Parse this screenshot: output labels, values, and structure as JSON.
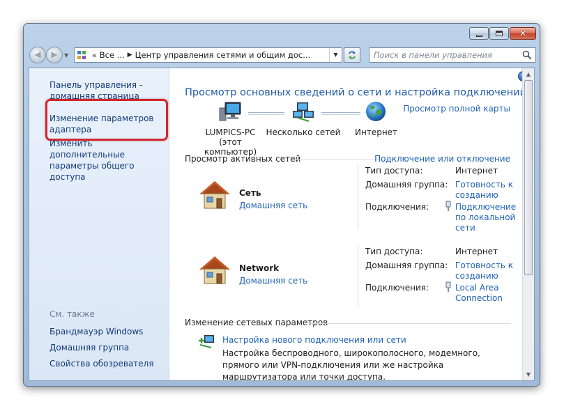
{
  "window": {
    "controls": {
      "minimize": "minimize",
      "maximize": "maximize",
      "close": "✕"
    }
  },
  "navbar": {
    "address": {
      "chevrons": "«",
      "crumb_1": "Все ...",
      "crumb_2": "Центр управления сетями и общим дос..."
    },
    "search": {
      "placeholder": "Поиск в панели управления"
    }
  },
  "sidebar": {
    "home_link": "Панель управления - домашняя страница",
    "adapter_link": "Изменение параметров адаптера",
    "sharing_link": "Изменить дополнительные параметры общего доступа",
    "see_also": "См. также",
    "see_also_items": [
      "Брандмауэр Windows",
      "Домашняя группа",
      "Свойства обозревателя"
    ]
  },
  "main": {
    "help": "?",
    "title": "Просмотр основных сведений о сети и настройка подключений",
    "full_map_link": "Просмотр полной карты",
    "map": {
      "pc_name": "LUMPICS-PC",
      "pc_sub": "(этот компьютер)",
      "networks": "Несколько сетей",
      "internet": "Интернет"
    },
    "active_networks": {
      "heading": "Просмотр активных сетей",
      "connect_link": "Подключение или отключение",
      "labels": {
        "access_type": "Тип доступа:",
        "homegroup": "Домашняя группа:",
        "connections": "Подключения:"
      },
      "items": [
        {
          "name": "Сеть",
          "type": "Домашняя сеть",
          "access": "Интернет",
          "homegroup": "Готовность к созданию",
          "connection": "Подключение по локальной сети"
        },
        {
          "name": "Network",
          "type": "Домашняя сеть",
          "access": "Интернет",
          "homegroup": "Готовность к созданию",
          "connection": "Local Area Connection"
        }
      ]
    },
    "change_settings": {
      "heading": "Изменение сетевых параметров",
      "new_connection_link": "Настройка нового подключения или сети",
      "new_connection_desc": "Настройка беспроводного, широкополосного, модемного, прямого или VPN-подключения или же настройка маршрутизатора или точки доступа."
    }
  },
  "colors": {
    "link": "#1e62b5",
    "title": "#1d5aa6",
    "highlight": "#d1262f",
    "sidebar_bg": "#e3edf9"
  }
}
